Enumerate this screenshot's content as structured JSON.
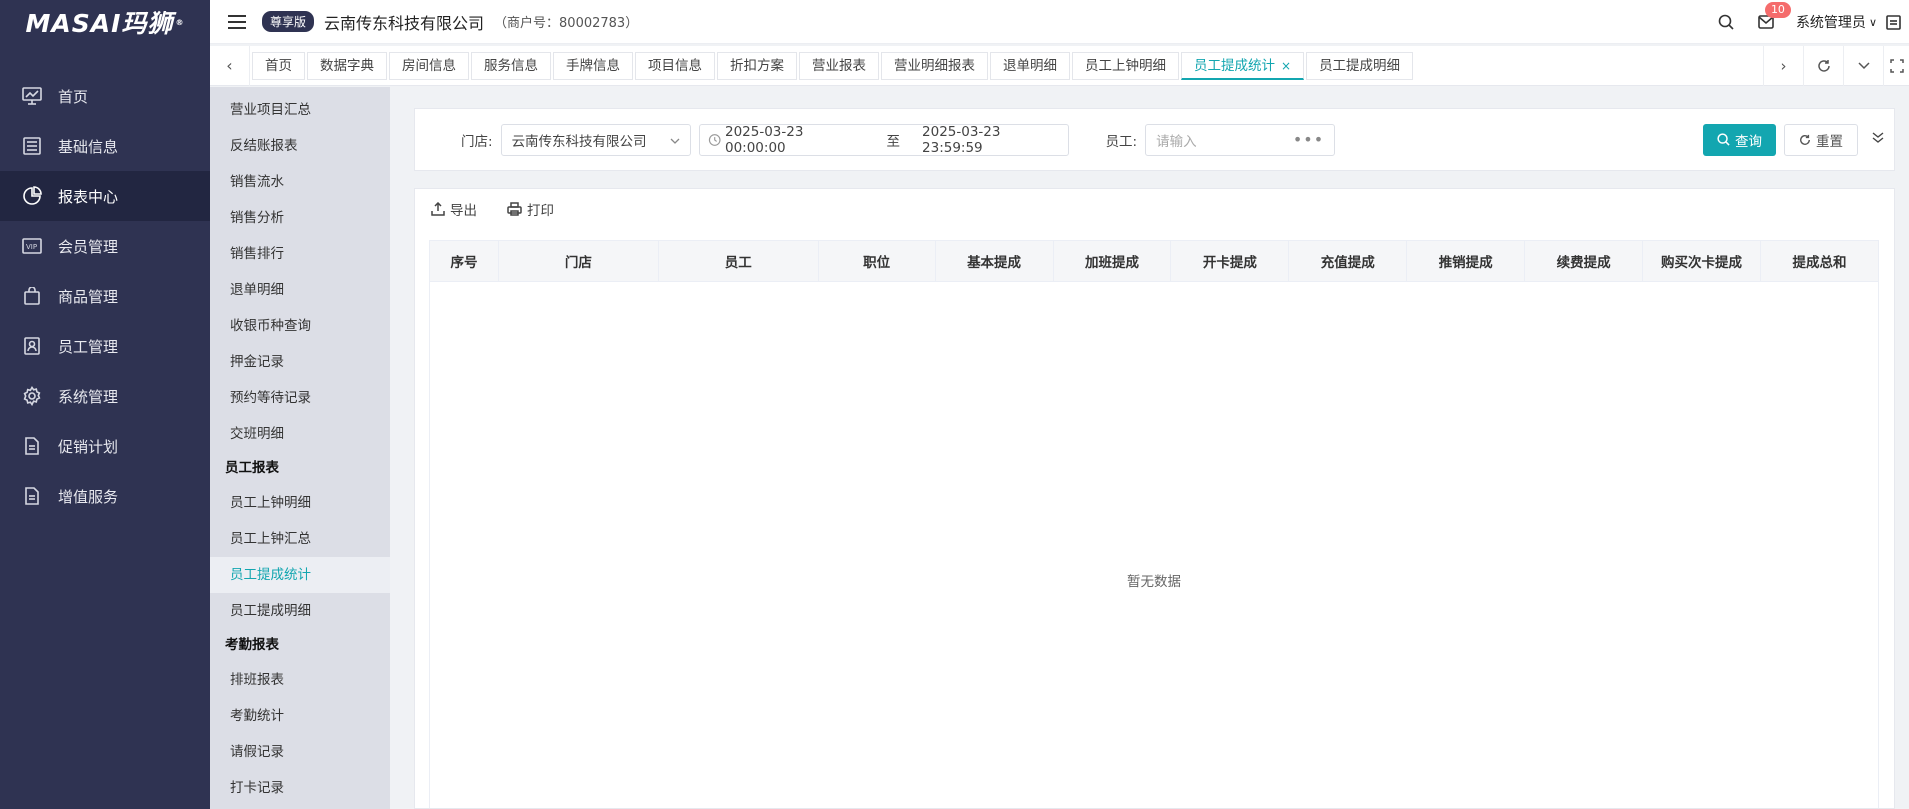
{
  "brand": {
    "logo_text": "MASAI玛狮",
    "logo_mark": "®"
  },
  "sidebar": {
    "items": [
      {
        "label": "首页",
        "icon": "monitor-chart-icon"
      },
      {
        "label": "基础信息",
        "icon": "list-icon"
      },
      {
        "label": "报表中心",
        "icon": "pie-chart-icon",
        "active": true
      },
      {
        "label": "会员管理",
        "icon": "vip-card-icon"
      },
      {
        "label": "商品管理",
        "icon": "shopping-bag-icon"
      },
      {
        "label": "员工管理",
        "icon": "staff-badge-icon"
      },
      {
        "label": "系统管理",
        "icon": "gear-icon"
      },
      {
        "label": "促销计划",
        "icon": "document-icon"
      },
      {
        "label": "增值服务",
        "icon": "document-icon"
      }
    ]
  },
  "header": {
    "edition": "尊享版",
    "company": "云南传东科技有限公司",
    "merchant": "（商户号：80002783）",
    "message_count": "10",
    "user": "系统管理员"
  },
  "tabs": [
    {
      "label": "首页"
    },
    {
      "label": "数据字典"
    },
    {
      "label": "房间信息"
    },
    {
      "label": "服务信息"
    },
    {
      "label": "手牌信息"
    },
    {
      "label": "项目信息"
    },
    {
      "label": "折扣方案"
    },
    {
      "label": "营业报表"
    },
    {
      "label": "营业明细报表"
    },
    {
      "label": "退单明细"
    },
    {
      "label": "员工上钟明细"
    },
    {
      "label": "员工提成统计",
      "active": true,
      "close": "×"
    },
    {
      "label": "员工提成明细"
    }
  ],
  "submenu": {
    "items": [
      {
        "label": "营业项目汇总",
        "type": "item"
      },
      {
        "label": "反结账报表",
        "type": "item"
      },
      {
        "label": "销售流水",
        "type": "item"
      },
      {
        "label": "销售分析",
        "type": "item"
      },
      {
        "label": "销售排行",
        "type": "item"
      },
      {
        "label": "退单明细",
        "type": "item"
      },
      {
        "label": "收银币种查询",
        "type": "item"
      },
      {
        "label": "押金记录",
        "type": "item"
      },
      {
        "label": "预约等待记录",
        "type": "item"
      },
      {
        "label": "交班明细",
        "type": "item"
      },
      {
        "label": "员工报表",
        "type": "group"
      },
      {
        "label": "员工上钟明细",
        "type": "item"
      },
      {
        "label": "员工上钟汇总",
        "type": "item"
      },
      {
        "label": "员工提成统计",
        "type": "item",
        "active": true
      },
      {
        "label": "员工提成明细",
        "type": "item"
      },
      {
        "label": "考勤报表",
        "type": "group"
      },
      {
        "label": "排班报表",
        "type": "item"
      },
      {
        "label": "考勤统计",
        "type": "item"
      },
      {
        "label": "请假记录",
        "type": "item"
      },
      {
        "label": "打卡记录",
        "type": "item"
      }
    ]
  },
  "filters": {
    "store_label": "门店:",
    "store_value": "云南传东科技有限公司",
    "date_start": "2025-03-23 00:00:00",
    "date_sep": "至",
    "date_end": "2025-03-23 23:59:59",
    "staff_label": "员工:",
    "staff_placeholder": "请输入",
    "query_label": "查询",
    "reset_label": "重置"
  },
  "toolbar": {
    "export_label": "导出",
    "print_label": "打印"
  },
  "table": {
    "columns": [
      "序号",
      "门店",
      "员工",
      "职位",
      "基本提成",
      "加班提成",
      "开卡提成",
      "充值提成",
      "推销提成",
      "续费提成",
      "购买次卡提成",
      "提成总和"
    ],
    "empty_text": "暂无数据"
  },
  "colors": {
    "accent": "#13a6b0",
    "sidebar_bg": "#2f3352",
    "badge": "#f56c6c"
  }
}
